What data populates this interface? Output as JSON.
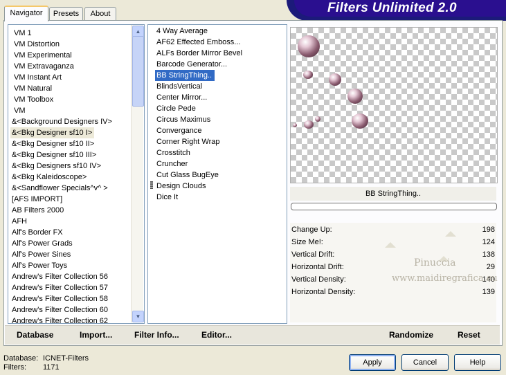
{
  "window_title": "Filters Unlimited 2.0",
  "tabs": [
    {
      "label": "Navigator",
      "active": true
    },
    {
      "label": "Presets",
      "active": false
    },
    {
      "label": "About",
      "active": false
    }
  ],
  "categories": [
    "VM 1",
    "VM Distortion",
    "VM Experimental",
    "VM Extravaganza",
    "VM Instant Art",
    "VM Natural",
    "VM Toolbox",
    "VM",
    "&<Background Designers IV>",
    "&<Bkg Designer sf10 I>",
    "&<Bkg Designer sf10 II>",
    "&<Bkg Designer sf10 III>",
    "&<Bkg Designers sf10 IV>",
    "&<Bkg Kaleidoscope>",
    "&<Sandflower Specials^v^ >",
    "[AFS IMPORT]",
    "AB Filters 2000",
    "AFH",
    "Alf's Border FX",
    "Alf's Power Grads",
    "Alf's Power Sines",
    "Alf's Power Toys",
    "Andrew's Filter Collection 56",
    "Andrew's Filter Collection 57",
    "Andrew's Filter Collection 58",
    "Andrew's Filter Collection 60",
    "Andrew's Filter Collection 62"
  ],
  "selected_category": "&<Bkg Designer sf10 I>",
  "filters": [
    "4 Way Average",
    "AF62 Effected Emboss...",
    "ALFs Border Mirror Bevel",
    "Barcode Generator...",
    "BB StringThing..",
    "BlindsVertical",
    "Center Mirror...",
    "Circle Pede",
    "Circus Maximus",
    "Convergance",
    "Corner Right Wrap",
    "Crosstitch",
    "Cruncher",
    "Cut Glass  BugEye",
    "Design Clouds",
    "Dice It"
  ],
  "selected_filter": "BB StringThing..",
  "preview_filter_name": "BB StringThing..",
  "progress": 0,
  "params": [
    {
      "label": "Change Up:",
      "value": "198"
    },
    {
      "label": "Size Me!:",
      "value": "124"
    },
    {
      "label": "Vertical Drift:",
      "value": "138"
    },
    {
      "label": "Horizontal Drift:",
      "value": "29"
    },
    {
      "label": "Vertical Density:",
      "value": "140"
    },
    {
      "label": "Horizontal Density:",
      "value": "139"
    }
  ],
  "watermark": {
    "line1": "Pinuccia",
    "line2": "www.maidiregrafica.eu"
  },
  "bottom_buttons": {
    "database": "Database",
    "import": "Import...",
    "filter_info": "Filter Info...",
    "editor": "Editor...",
    "randomize": "Randomize",
    "reset": "Reset"
  },
  "status": {
    "database_label": "Database:",
    "database_value": "ICNET-Filters",
    "filters_label": "Filters:",
    "filters_value": "1171"
  },
  "dialog_buttons": {
    "apply": "Apply",
    "cancel": "Cancel",
    "help": "Help"
  },
  "colors": {
    "banner": "#2a0f8f",
    "selection": "#316ac5",
    "category_selected_bg": "#ece9d8"
  }
}
